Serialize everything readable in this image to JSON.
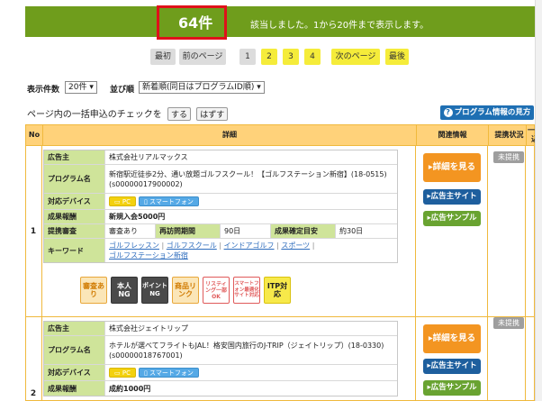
{
  "banner": {
    "count": "64件",
    "message": "該当しました。1から20件まで表示します。"
  },
  "pager": {
    "first": "最初",
    "prev": "前のページ",
    "pages": [
      "1",
      "2",
      "3",
      "4"
    ],
    "next": "次のページ",
    "last": "最後"
  },
  "options": {
    "per_page_label": "表示件数",
    "per_page_value": "20件 ▾",
    "sort_label": "並び順",
    "sort_value": "新着順(同日はプログラムID順) ▾"
  },
  "bulk": {
    "label": "ページ内の一括申込のチェックを",
    "check_all": "する",
    "uncheck_all": "はずす",
    "help": "プログラム情報の見方",
    "help_icon": "?"
  },
  "table_header": {
    "no": "No",
    "detail": "詳細",
    "related": "関連情報",
    "status": "提携状況",
    "bulk_apply": "一括申込み"
  },
  "rows": [
    {
      "no": "1",
      "advertiser_label": "広告主",
      "advertiser": "株式会社リアルマックス",
      "program_label": "プログラム名",
      "program": "新宿駅近徒歩2分、通い放題ゴルフスクール！【ゴルフステーション新宿】(18-0515)(s00000017900002)",
      "device_label": "対応デバイス",
      "device_pc": "PC",
      "device_sp": "スマートフォン",
      "reward_label": "成果報酬",
      "reward": "新規入会5000円",
      "review_label": "提携審査",
      "review": "審査あり",
      "cookie_label": "再訪問期間",
      "cookie": "90日",
      "confirm_label": "成果確定目安",
      "confirm": "約30日",
      "keyword_label": "キーワード",
      "keywords": [
        "ゴルフレッスン",
        "ゴルフスクール",
        "インドアゴルフ",
        "スポーツ",
        "ゴルフステーション新宿"
      ],
      "badges": [
        "審査あり",
        "本人NG",
        "ポイントNG",
        "商品リンク",
        "リスティング一部OK",
        "スマートフォン最適化サイト対応",
        "ITP対応"
      ],
      "status": "未提携",
      "detail_btn": "詳細を見る",
      "site_btn": "広告主サイト",
      "sample_btn": "広告サンプル"
    },
    {
      "no": "2",
      "advertiser_label": "広告主",
      "advertiser": "株式会社ジェイトリップ",
      "program_label": "プログラム名",
      "program": "ホテルが選べてフライトもJAL！格安国内旅行のJ-TRIP（ジェイトリップ）(18-0330)(s00000018767001)",
      "device_label": "対応デバイス",
      "device_pc": "PC",
      "device_sp": "スマートフォン",
      "reward_label": "成果報酬",
      "reward": "成約1000円",
      "status": "未提携",
      "detail_btn": "詳細を見る",
      "site_btn": "広告主サイト",
      "sample_btn": "広告サンプル"
    }
  ],
  "colors": {
    "banner": "#6f9d1c",
    "highlight": "#e0111a",
    "header": "#ffd27a",
    "label_bg": "#cfe49a",
    "orange_btn": "#f39521",
    "blue_btn": "#1e5f9e",
    "green_btn": "#69a331"
  }
}
